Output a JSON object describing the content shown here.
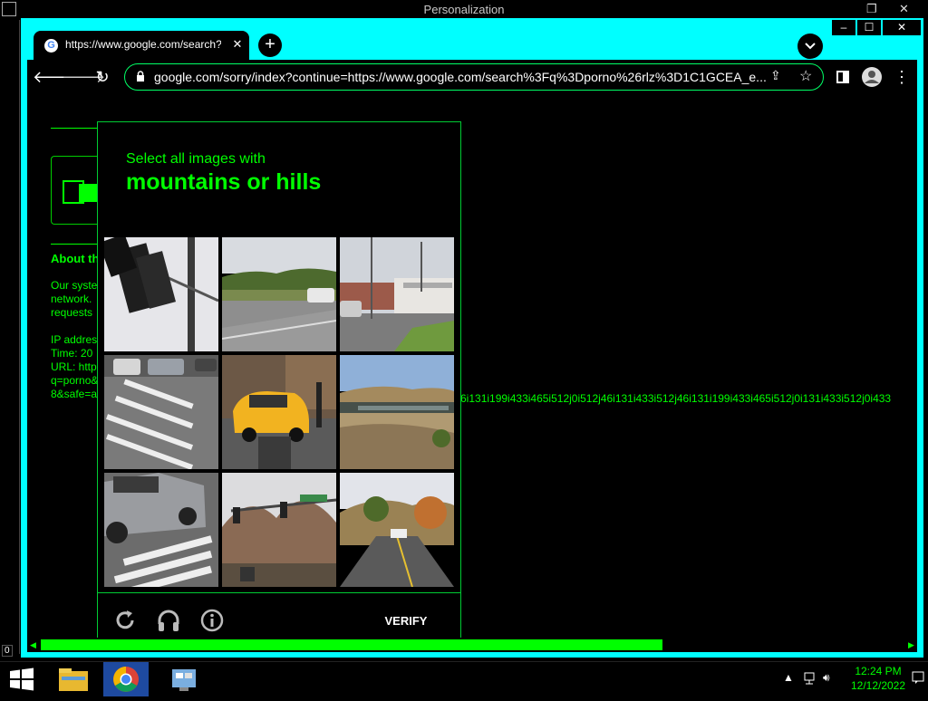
{
  "background_window": {
    "title": "Personalization"
  },
  "bg_corner_label": "0",
  "browser": {
    "tab": {
      "title": "https://www.google.com/search?q=porno&rlz",
      "favicon": "G"
    },
    "address_bar": {
      "url": "google.com/sorry/index?continue=https://www.google.com/search%3Fq%3Dporno%26rlz%3D1C1GCEA_e..."
    },
    "window_controls": {
      "minimize": "–",
      "maximize": "☐",
      "close": "✕"
    }
  },
  "page": {
    "about_heading": "About th",
    "para1": [
      "Our syste",
      "network.",
      "requests"
    ],
    "para2": [
      "IP addres",
      "Time: 20",
      "URL: http",
      "q=porno&",
      "8&safe=a"
    ],
    "long_text": "6i131i199i433i465i512j0i512j46i131i433i512j46i131i199i433i465i512j0i131i433i512j0i433"
  },
  "captcha": {
    "instruction": "Select all images with",
    "target": "mountains or hills",
    "verify_label": "VERIFY",
    "tiles": [
      {
        "subject": "traffic light"
      },
      {
        "subject": "highway with trees"
      },
      {
        "subject": "street with buildings"
      },
      {
        "subject": "crosswalk with cars"
      },
      {
        "subject": "yellow taxi"
      },
      {
        "subject": "bridge over canyon"
      },
      {
        "subject": "pickup truck crosswalk"
      },
      {
        "subject": "traffic lights and trees"
      },
      {
        "subject": "road with hills"
      }
    ]
  },
  "taskbar": {
    "time": "12:24 PM",
    "date": "12/12/2022"
  }
}
